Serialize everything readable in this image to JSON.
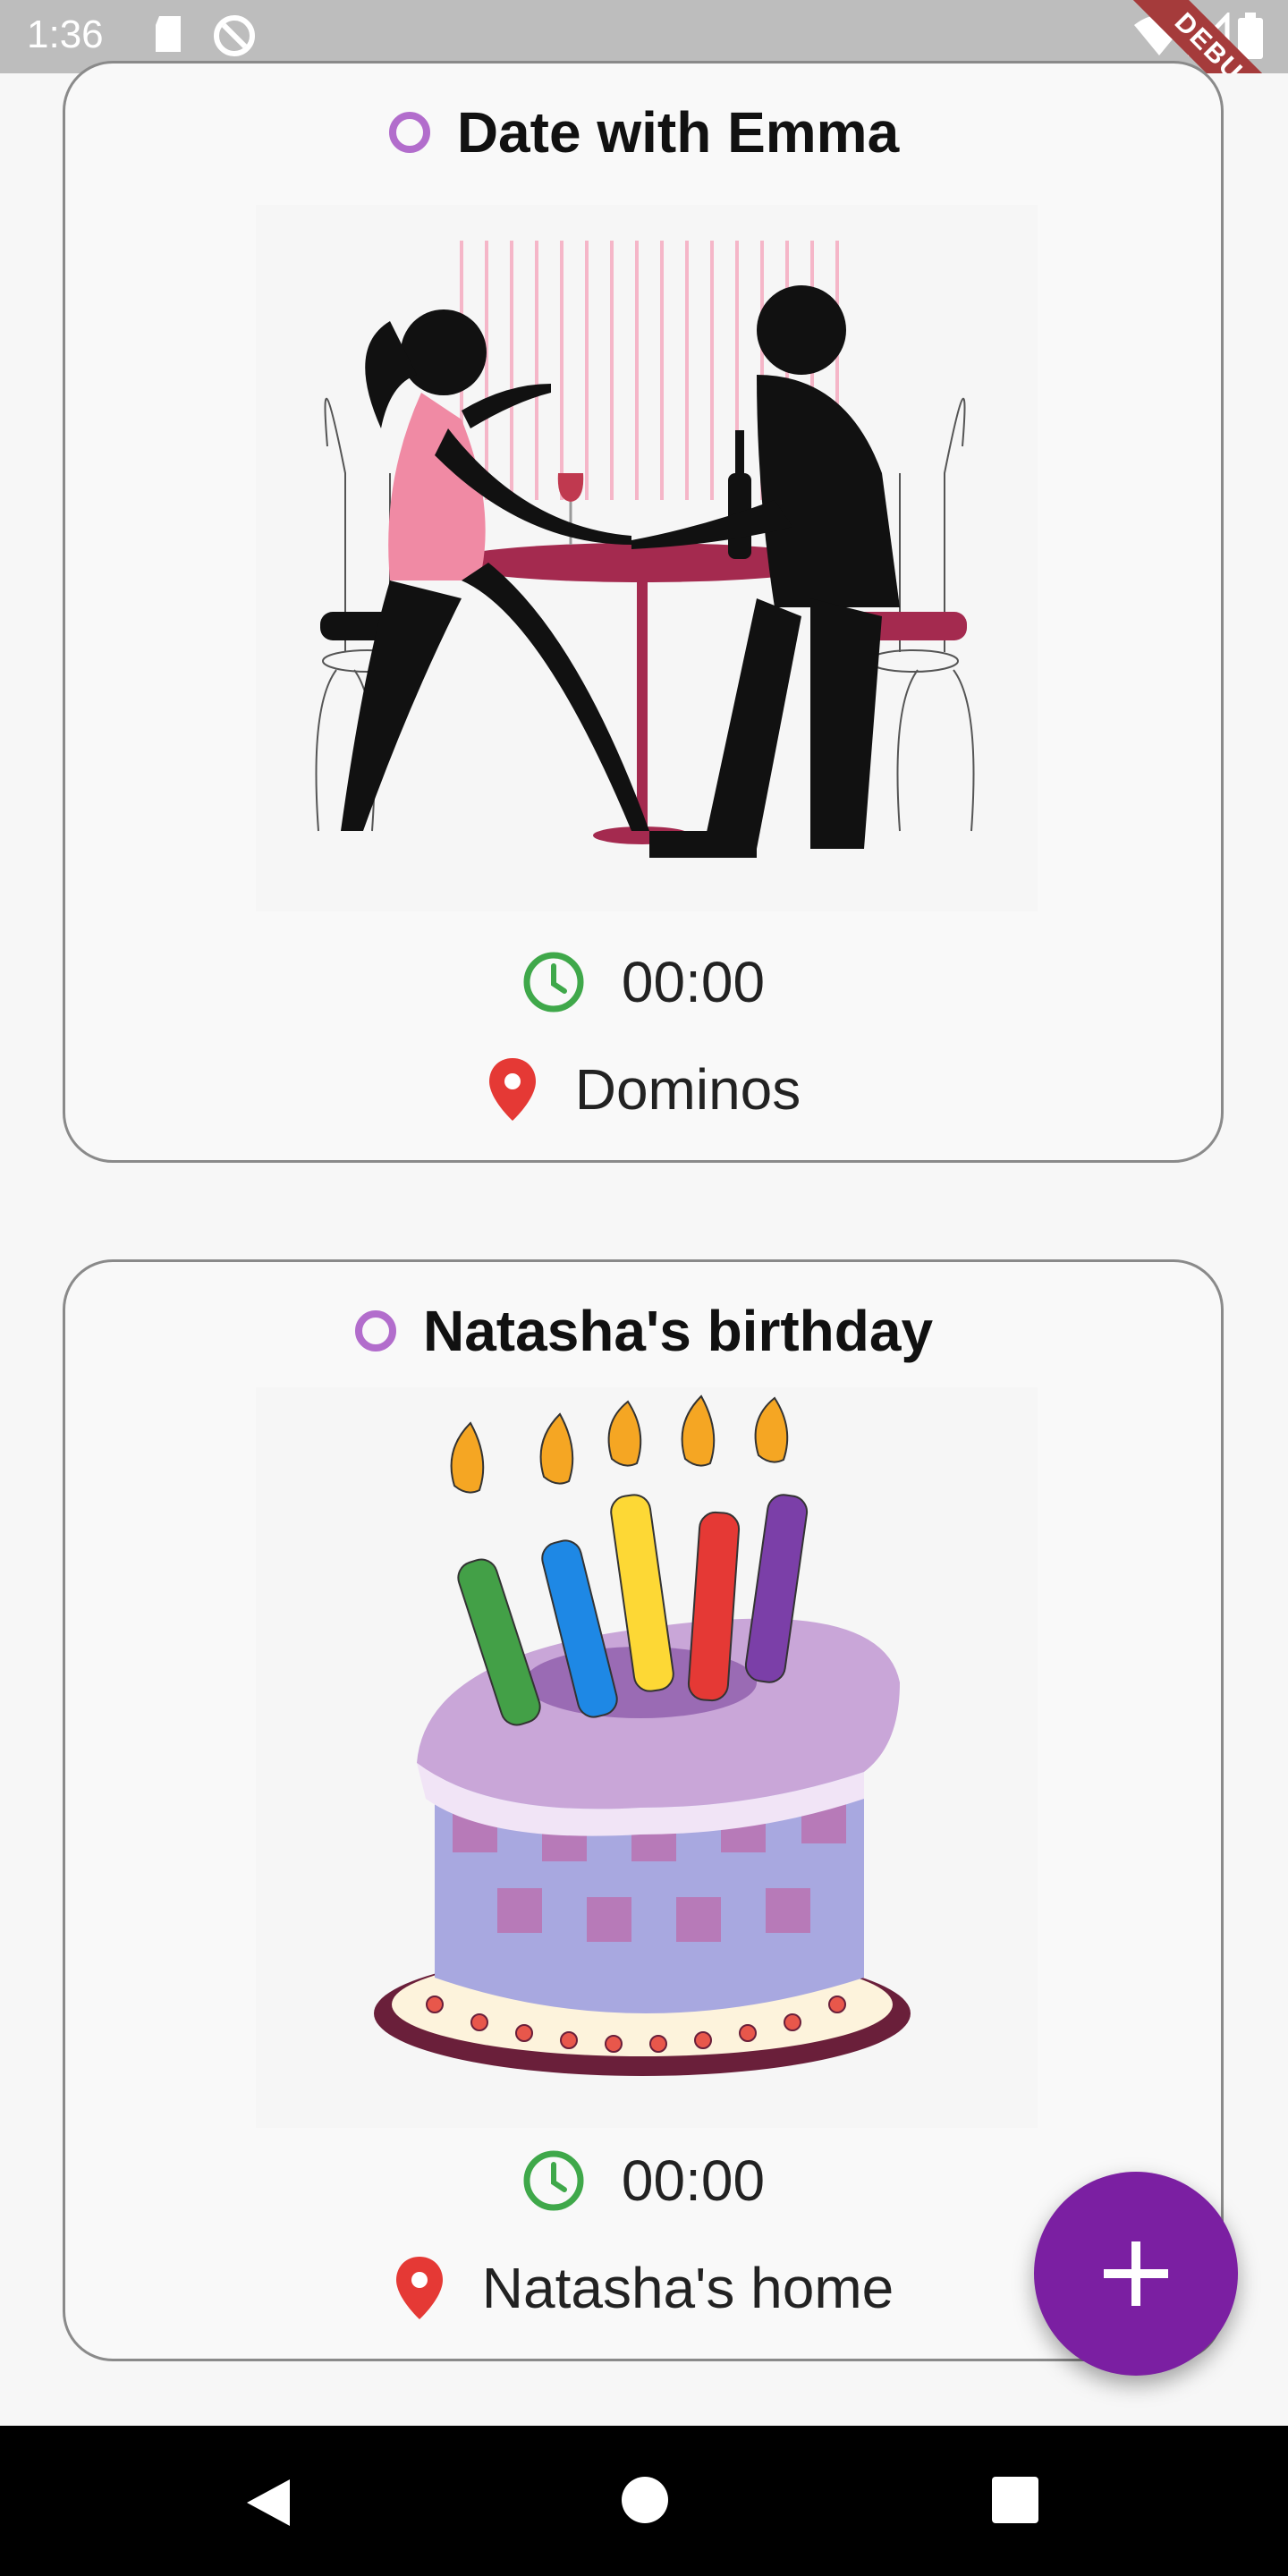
{
  "status_bar": {
    "time": "1:36",
    "icons": [
      "sd-card-icon",
      "sync-icon",
      "wifi-icon",
      "signal-icon",
      "battery-icon"
    ],
    "debug_label": "DEBUG"
  },
  "events": [
    {
      "title": "Date with Emma",
      "image": "couple-dinner-silhouette",
      "time": "00:00",
      "location": "Dominos"
    },
    {
      "title": "Natasha's birthday",
      "image": "birthday-cake-with-candles",
      "time": "00:00",
      "location": "Natasha's home"
    }
  ],
  "fab": {
    "icon": "plus-icon"
  },
  "nav_bar": {
    "buttons": [
      "back-icon",
      "home-icon",
      "recents-icon"
    ]
  },
  "colors": {
    "accent": "#7b1fa2",
    "title_ring": "#b26dcc",
    "clock": "#3fa84a",
    "pin": "#e53935"
  }
}
